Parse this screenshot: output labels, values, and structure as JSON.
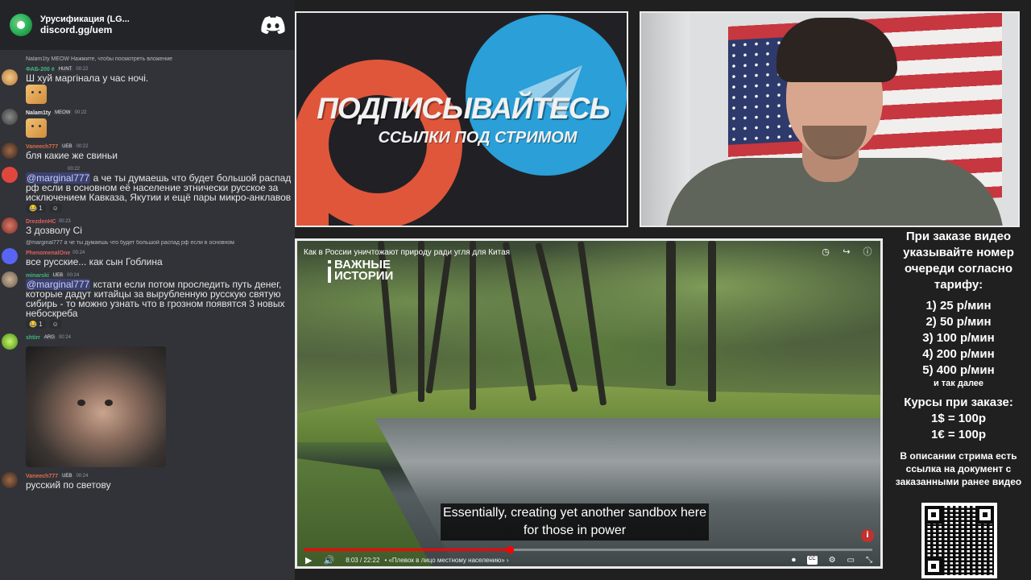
{
  "chat": {
    "server_name": "Урусификация (LG...",
    "server_invite": "discord.gg/uem",
    "messages": [
      {
        "reply": "Nalam1ty MEOW Нажмите, чтобы посмотреть вложение",
        "user": "ФАБ-200 ё",
        "user_color": "#43b581",
        "badge": "HUNT",
        "time": "00:22",
        "text": "Ш хуй маргінала у час ночі.",
        "has_emoji": true
      },
      {
        "user": "Nalam1ty",
        "user_color": "#e8e8e8",
        "badge": "MEOW",
        "time": "00:22",
        "has_emoji": true
      },
      {
        "user": "Vaneech777",
        "user_color": "#e06c4b",
        "badge": "UEB",
        "time": "00:22",
        "text": "бля какие же свиньи"
      },
      {
        "time": "00:22",
        "mention": "@marginal777",
        "text": " а че ты думаешь что будет большой распад рф если в основном её население этнически русское за исключением Кавказа, Якутии и ещё пары микро-анклавов",
        "reactions": [
          "😂 1",
          "☺"
        ]
      },
      {
        "user": "DrezdenHC",
        "user_color": "#e05f5f",
        "time": "00:23",
        "text": "З дозволу Сі"
      },
      {
        "reply": "@marginal777 а че ты думаешь что будет большой распад рф если в основном",
        "user": "PhenomenalOne",
        "user_color": "#e05f5f",
        "time": "00:24",
        "text": "все русские... как сын Гоблина"
      },
      {
        "user": "minarski",
        "user_color": "#43b581",
        "badge": "UEB",
        "time": "00:24",
        "mention": "@marginal777",
        "text": " кстати если потом проследить путь денег, которые дадут китайцы за вырубленную русскую святую сибирь - то можно узнать что в грозном появятся 3 новых небоскреба",
        "reactions": [
          "😂 1",
          "☺"
        ]
      },
      {
        "user": "shtirr",
        "user_color": "#43b581",
        "badge": "ARG",
        "time": "00:24",
        "has_image": true
      },
      {
        "user": "Vaneech777",
        "user_color": "#e06c4b",
        "badge": "UEB",
        "time": "00:24",
        "text": "русский по светову"
      }
    ]
  },
  "promo": {
    "title": "ПОДПИСЫВАЙТЕСЬ",
    "subtitle": "ССЫЛКИ ПОД СТРИМОМ",
    "colors": {
      "patreon": "#e0563b",
      "telegram": "#2a9fd8"
    }
  },
  "video": {
    "title": "Как в России уничтожают природу ради угля для Китая",
    "brand_line1": "ВАЖНЫЕ",
    "brand_line2": "ИСТОРИИ",
    "caption_line1": "Essentially, creating yet another sandbox here",
    "caption_line2": "for those in power",
    "time": "8:03 / 22:22",
    "chapter": "• «Плевок в лицо местному населению» ›",
    "progress": 0.362,
    "icons": {
      "watch_later": "clock-icon",
      "share": "share-icon",
      "info": "info-icon"
    }
  },
  "info": {
    "heading": "При заказе видео указывайте номер очереди согласно тарифу:",
    "tariffs": [
      "1) 25 р/мин",
      "2) 50 р/мин",
      "3) 100 р/мин",
      "4) 200 р/мин",
      "5) 400 р/мин"
    ],
    "tariffs_more": "и так далее",
    "rates_heading": "Курсы при заказе:",
    "rates": [
      "1$ = 100р",
      "1€ = 100р"
    ],
    "description": "В описании стрима есть ссылка на документ с заказанными ранее видео"
  }
}
